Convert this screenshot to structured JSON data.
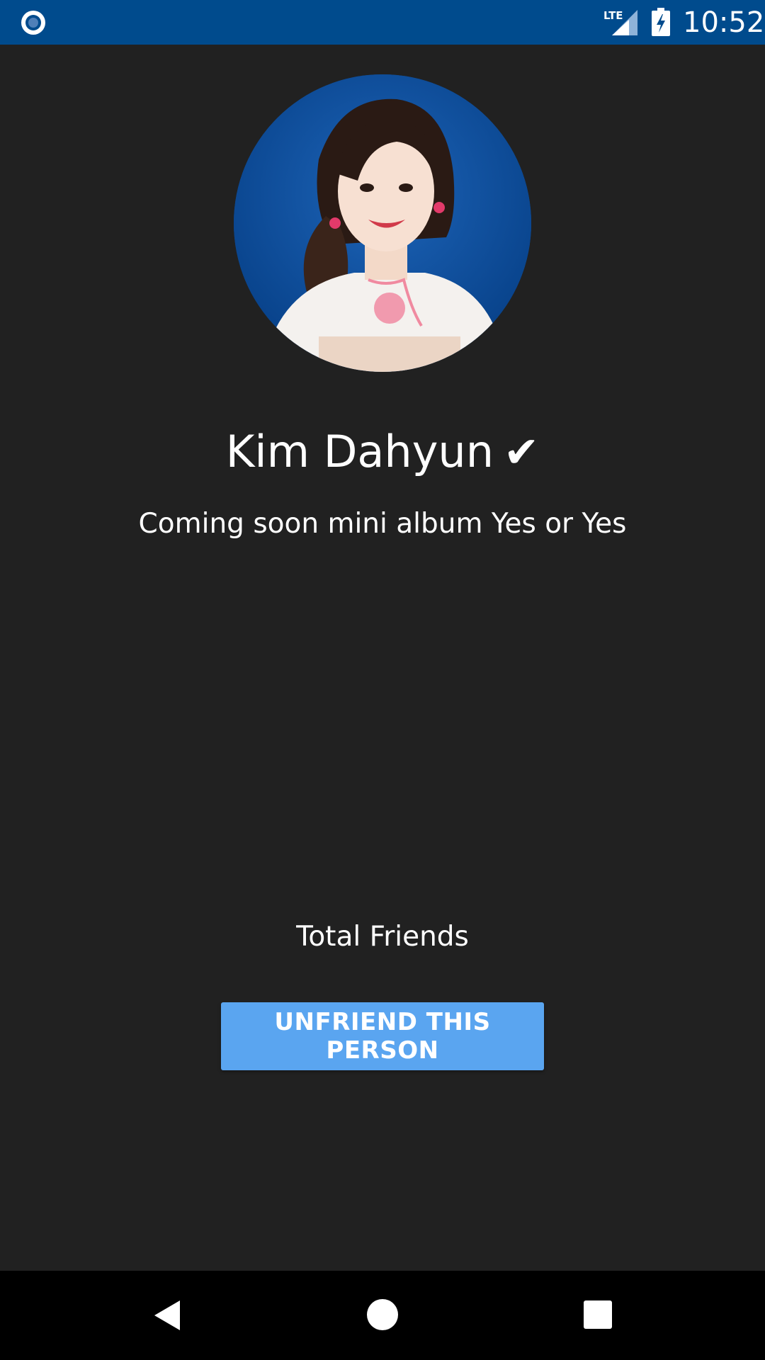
{
  "status_bar": {
    "time": "10:52",
    "network": "LTE",
    "app_icon": "radio-button-icon",
    "signal_icon": "signal-icon",
    "battery_icon": "battery-charging-icon",
    "background_color": "#004b8d"
  },
  "profile": {
    "name": "Kim Dahyun",
    "verified_mark": "✔",
    "status": "Coming soon mini album Yes or Yes",
    "avatar_icon": "profile-photo"
  },
  "friends": {
    "label": "Total Friends"
  },
  "actions": {
    "unfriend_label": "UNFRIEND THIS PERSON",
    "button_color": "#5aa5f0"
  },
  "nav_bar": {
    "back_icon": "back-triangle-icon",
    "home_icon": "home-circle-icon",
    "recents_icon": "recents-square-icon"
  },
  "theme": {
    "background": "#212121",
    "text": "#ffffff"
  }
}
